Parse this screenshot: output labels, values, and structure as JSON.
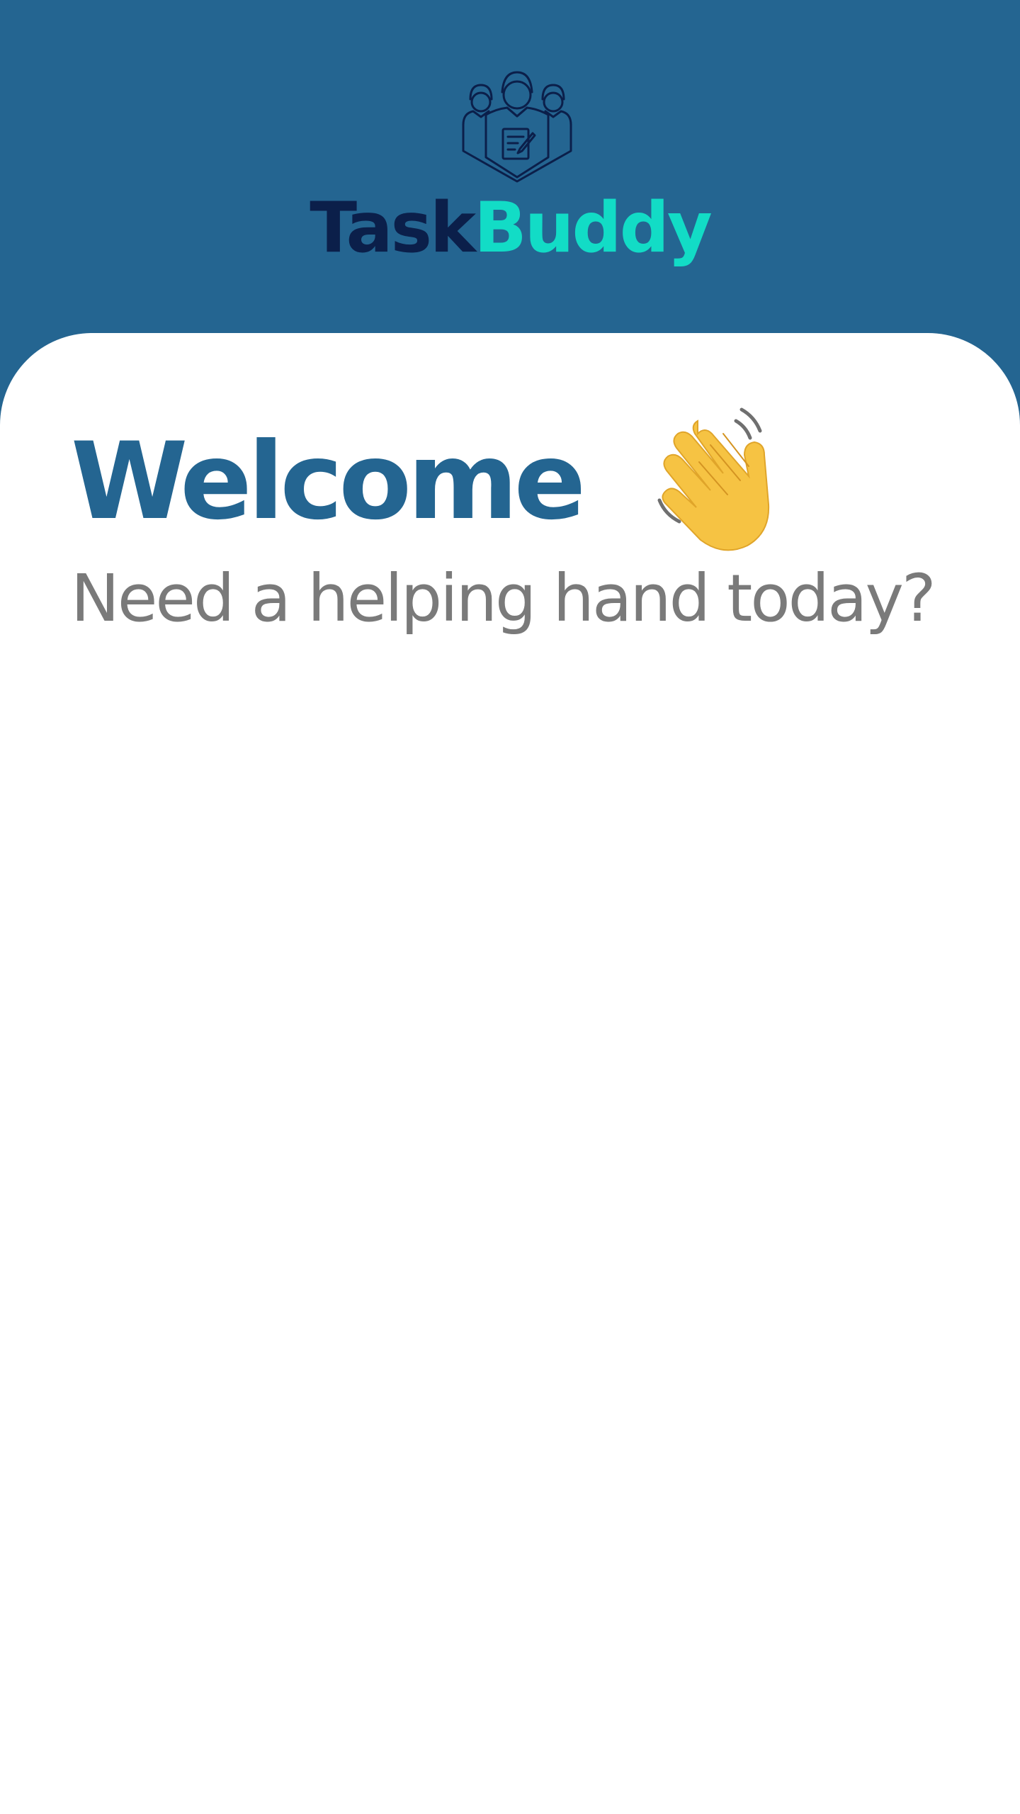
{
  "header": {
    "logo_icon": "team-document-icon",
    "brand_first": "Task",
    "brand_second": "Buddy",
    "colors": {
      "background": "#246591",
      "brand_first": "#0b1f4a",
      "brand_second": "#12dcc6"
    }
  },
  "main": {
    "title": "Welcome",
    "title_icon": "waving-hand-icon",
    "subtitle": "Need a helping hand today?",
    "colors": {
      "title": "#246591",
      "subtitle": "#7a7a7a"
    }
  }
}
